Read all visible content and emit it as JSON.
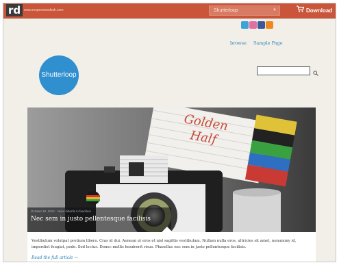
{
  "header": {
    "logo": "rd",
    "domain": "www.responsivedesk.com",
    "theme_select": "Shutterloop",
    "download_label": "Download"
  },
  "social": [
    "twitter-icon",
    "dribbble-icon",
    "facebook-icon",
    "rss-icon"
  ],
  "nav": {
    "items": [
      "browse",
      "Sample Page"
    ]
  },
  "brand": "Shutterloop",
  "search": {
    "placeholder": ""
  },
  "hero": {
    "meta": "October 10, 2012 · Nunc lobortis in faucibus",
    "title": "Nec sem in justo pellentesque facilisis",
    "box_text_line1": "Golden",
    "box_text_line2": "Half"
  },
  "excerpt": {
    "text": "Vestibulum volutpat pretium libero. Cras id dui. Aenean ut eros et nisl sagittis vestibulum. Nullam nulla eros, ultricies sit amet, nonummy id, imperdiet feugiat, pede. Sed lectus. Donec mollis hendrerit risus. Phasellus nec sem in justo pellentesque facilisis.",
    "read_more": "Read the full article →"
  },
  "colors": {
    "topbar": "#c9563a",
    "accent": "#2f8fcf",
    "link": "#2a7fb8"
  }
}
